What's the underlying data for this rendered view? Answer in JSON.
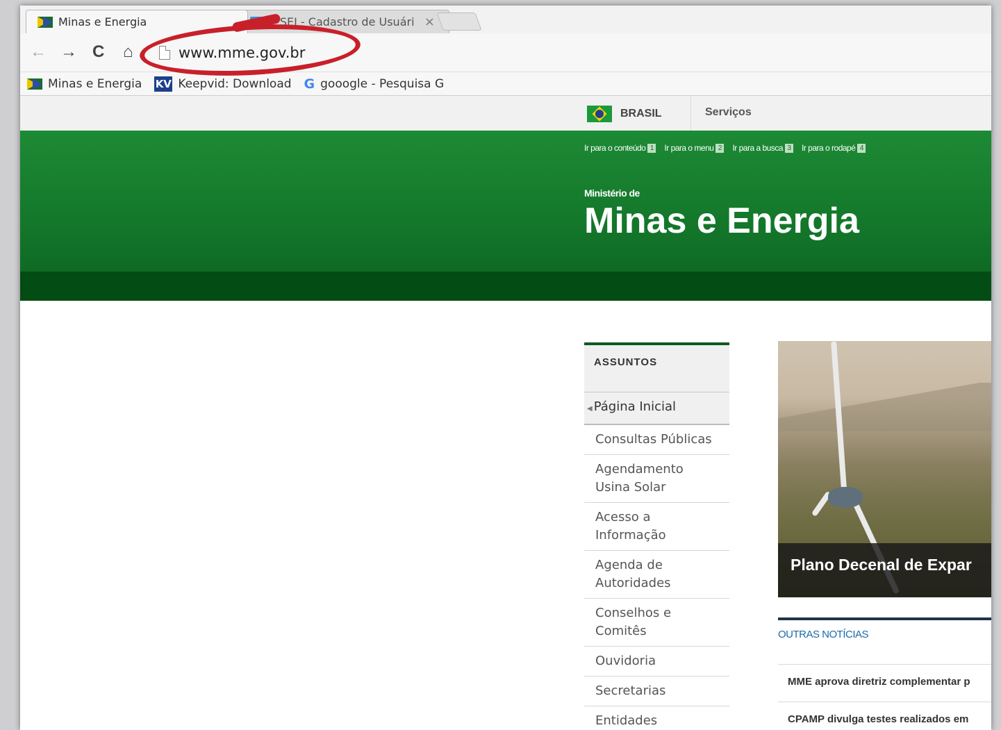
{
  "browser": {
    "tabs": [
      {
        "title": "Minas e Energia",
        "active": true
      },
      {
        "badge": "sei",
        "title": ":: SEI - Cadastro de Usuári",
        "active": false
      }
    ],
    "tab_close_glyph": "×",
    "url": "www.mme.gov.br",
    "bookmarks": [
      {
        "label": "Minas e Energia",
        "icon": "mme-favicon-icon"
      },
      {
        "badge": "KV",
        "label": "Keepvid: Download",
        "icon": "keepvid-icon"
      },
      {
        "badge": "G",
        "label": "gooogle - Pesquisa G",
        "icon": "google-icon"
      }
    ],
    "annotation_color": "#c8202a"
  },
  "gov_bar": {
    "brasil": "BRASIL",
    "servicos": "Serviços"
  },
  "header": {
    "skip_links": [
      {
        "label": "Ir para o conteúdo",
        "key": "1"
      },
      {
        "label": "Ir para o menu",
        "key": "2"
      },
      {
        "label": "Ir para a busca",
        "key": "3"
      },
      {
        "label": "Ir para o rodapé",
        "key": "4"
      }
    ],
    "ministerio": "Ministério de",
    "title": "Minas e Energia",
    "green": "#1d8a35",
    "dark_green": "#034c14"
  },
  "sidebar": {
    "heading": "ASSUNTOS",
    "items": [
      {
        "label": "Página Inicial"
      },
      {
        "label": "Consultas Públicas"
      },
      {
        "label": "Agendamento Usina Solar"
      },
      {
        "label": "Acesso a Informação"
      },
      {
        "label": "Agenda de Autoridades"
      },
      {
        "label": "Conselhos e Comitês"
      },
      {
        "label": "Ouvidoria"
      },
      {
        "label": "Secretarias"
      },
      {
        "label": "Entidades"
      }
    ]
  },
  "banner": {
    "caption": "Plano Decenal de Expar"
  },
  "news": {
    "heading": "OUTRAS NOTÍCIAS",
    "items": [
      "MME aprova diretriz complementar p",
      "CPAMP divulga testes realizados em"
    ]
  }
}
